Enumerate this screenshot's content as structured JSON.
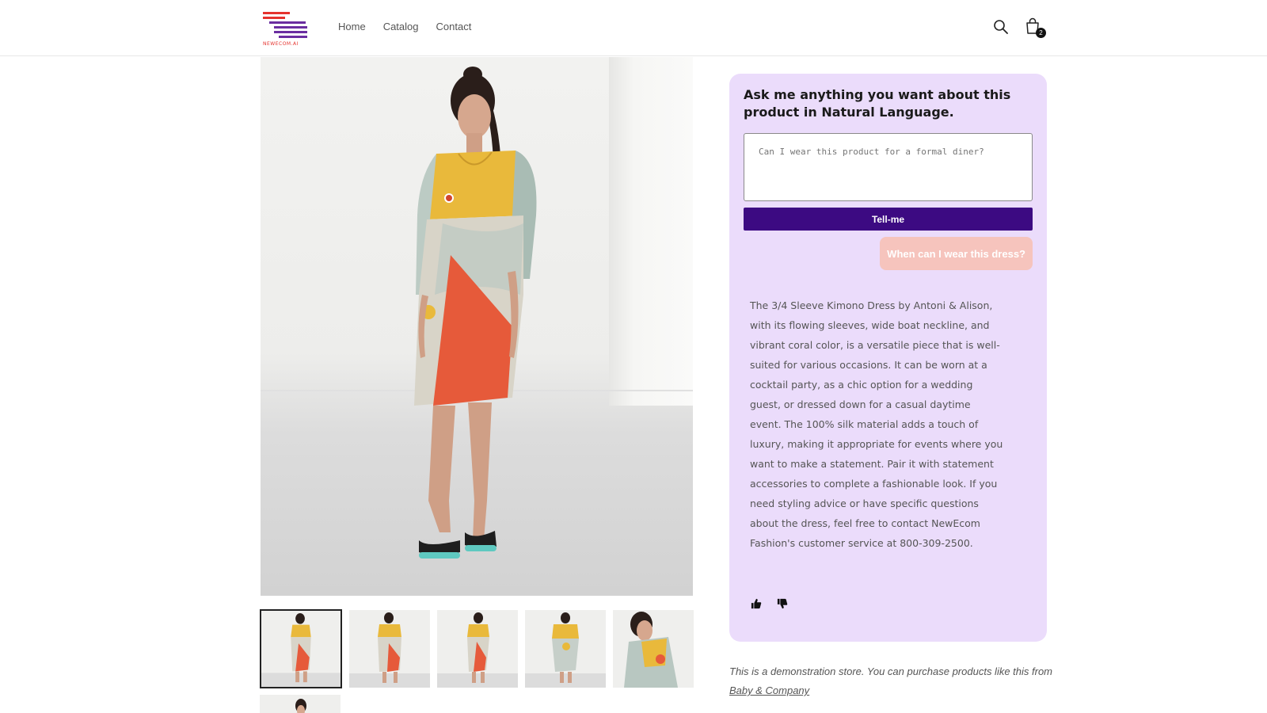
{
  "brand": {
    "logo_text": "NEWECOM.AI"
  },
  "nav": {
    "items": [
      "Home",
      "Catalog",
      "Contact"
    ]
  },
  "header": {
    "cart_count": "2",
    "search_icon": "search-icon",
    "cart_icon": "shopping-bag-icon"
  },
  "gallery": {
    "thumbnail_count": 6,
    "active_index": 0
  },
  "chat": {
    "title": "Ask me anything you want about this product in Natural Language.",
    "input_placeholder": "Can I wear this product for a formal diner?",
    "submit_label": "Tell-me",
    "user_question": "When can I wear this dress?",
    "answer": "The 3/4 Sleeve Kimono Dress by Antoni & Alison, with its flowing sleeves, wide boat neckline, and vibrant coral color, is a versatile piece that is well-suited for various occasions. It can be worn at a cocktail party, as a chic option for a wedding guest, or dressed down for a casual daytime event. The 100% silk material adds a touch of luxury, making it appropriate for events where you want to make a statement. Pair it with statement accessories to complete a fashionable look. If you need styling advice or have specific questions about the dress, feel free to contact NewEcom Fashion's customer service at 800-309-2500.",
    "thumbs_up_icon": "thumbs-up-icon",
    "thumbs_down_icon": "thumbs-down-icon"
  },
  "disclaimer": {
    "text": "This is a demonstration store. You can purchase products like this from ",
    "link_text": "Baby & Company"
  },
  "colors": {
    "accent": "#3c0a82",
    "panel_bg": "#ebdcfb",
    "bubble_bg": "#f6c4bd"
  }
}
